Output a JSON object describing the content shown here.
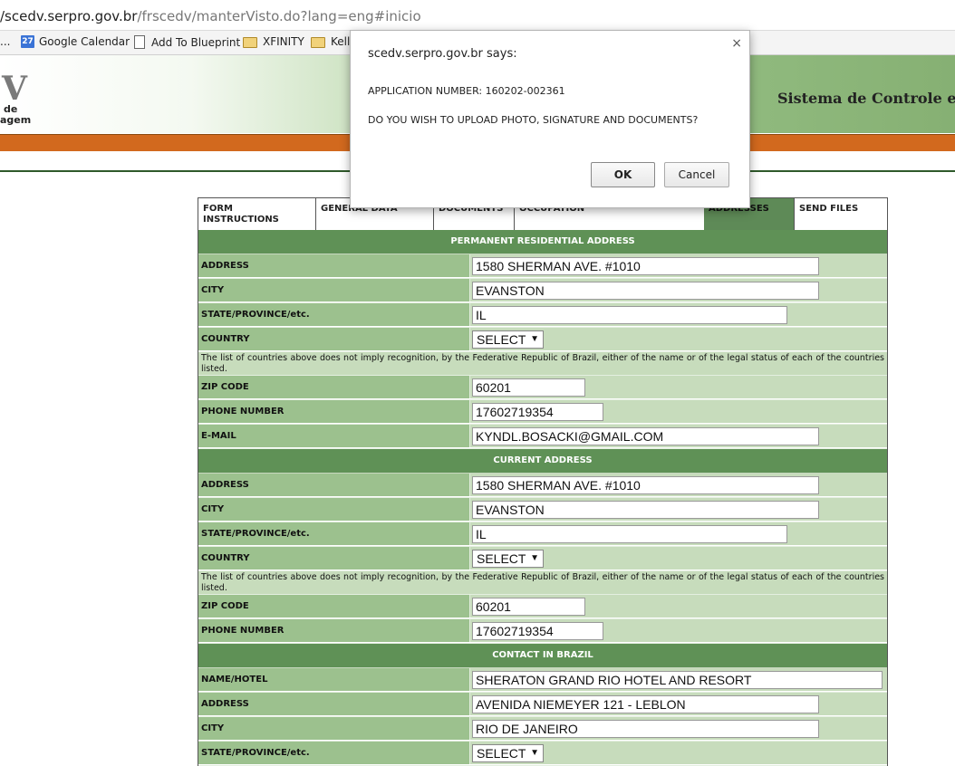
{
  "browser": {
    "url_host": "/scedv.serpro.gov.br",
    "url_path": "/frscedv/manterVisto.do?lang=eng#inicio",
    "bookmarks": [
      {
        "label": "..."
      },
      {
        "label": "Google Calendar",
        "icon": "calendar-icon",
        "badge": "27"
      },
      {
        "label": "Add To Blueprint",
        "icon": "page-icon"
      },
      {
        "label": "XFINITY",
        "icon": "folder-icon"
      },
      {
        "label": "Kello",
        "icon": "folder-icon"
      }
    ]
  },
  "header": {
    "logo_letter": "V",
    "logo_line1": "de",
    "logo_line2": "agem",
    "system_title": "Sistema de Controle e"
  },
  "tabs": [
    {
      "label": "FORM INSTRUCTIONS",
      "active": false
    },
    {
      "label": "GENERAL DATA",
      "active": false
    },
    {
      "label": "DOCUMENTS",
      "active": false
    },
    {
      "label": "OCCUPATION",
      "active": false
    },
    {
      "label": "",
      "active": false
    },
    {
      "label": "ADDRESSES",
      "active": true
    },
    {
      "label": "SEND FILES",
      "active": false
    }
  ],
  "form": {
    "permanent": {
      "header": "PERMANENT RESIDENTIAL ADDRESS",
      "address_label": "ADDRESS",
      "address_value": "1580 SHERMAN AVE. #1010",
      "city_label": "CITY",
      "city_value": "EVANSTON",
      "state_label": "STATE/PROVINCE/etc.",
      "state_value": "IL",
      "country_label": "COUNTRY",
      "country_value": "SELECT",
      "note": "The list of countries above does not imply recognition, by the Federative Republic of Brazil, either of the name or of the legal status of each of the countries listed.",
      "zip_label": "ZIP CODE",
      "zip_value": "60201",
      "phone_label": "PHONE NUMBER",
      "phone_value": "17602719354",
      "email_label": "E-MAIL",
      "email_value": "KYNDL.BOSACKI@GMAIL.COM"
    },
    "current": {
      "header": "CURRENT ADDRESS",
      "address_label": "ADDRESS",
      "address_value": "1580 SHERMAN AVE. #1010",
      "city_label": "CITY",
      "city_value": "EVANSTON",
      "state_label": "STATE/PROVINCE/etc.",
      "state_value": "IL",
      "country_label": "COUNTRY",
      "country_value": "SELECT",
      "note": "The list of countries above does not imply recognition, by the Federative Republic of Brazil, either of the name or of the legal status of each of the countries listed.",
      "zip_label": "ZIP CODE",
      "zip_value": "60201",
      "phone_label": "PHONE NUMBER",
      "phone_value": "17602719354"
    },
    "brazil": {
      "header": "CONTACT IN BRAZIL",
      "name_label": "NAME/HOTEL",
      "name_value": "SHERATON GRAND RIO HOTEL AND RESORT",
      "address_label": "ADDRESS",
      "address_value": "AVENIDA NIEMEYER 121 - LEBLON",
      "city_label": "CITY",
      "city_value": "RIO DE JANEIRO",
      "state_label": "STATE/PROVINCE/etc.",
      "state_value": "SELECT"
    }
  },
  "dialog": {
    "title": "scedv.serpro.gov.br says:",
    "close": "×",
    "line1": "APPLICATION NUMBER: 160202-002361",
    "line2": "DO YOU WISH TO UPLOAD PHOTO, SIGNATURE AND DOCUMENTS?",
    "ok": "OK",
    "cancel": "Cancel"
  },
  "colors": {
    "section_header": "#5f9156",
    "label_cell": "#9cc18e",
    "field_cell": "#c7dcbc",
    "orange_bar": "#d2691e"
  }
}
